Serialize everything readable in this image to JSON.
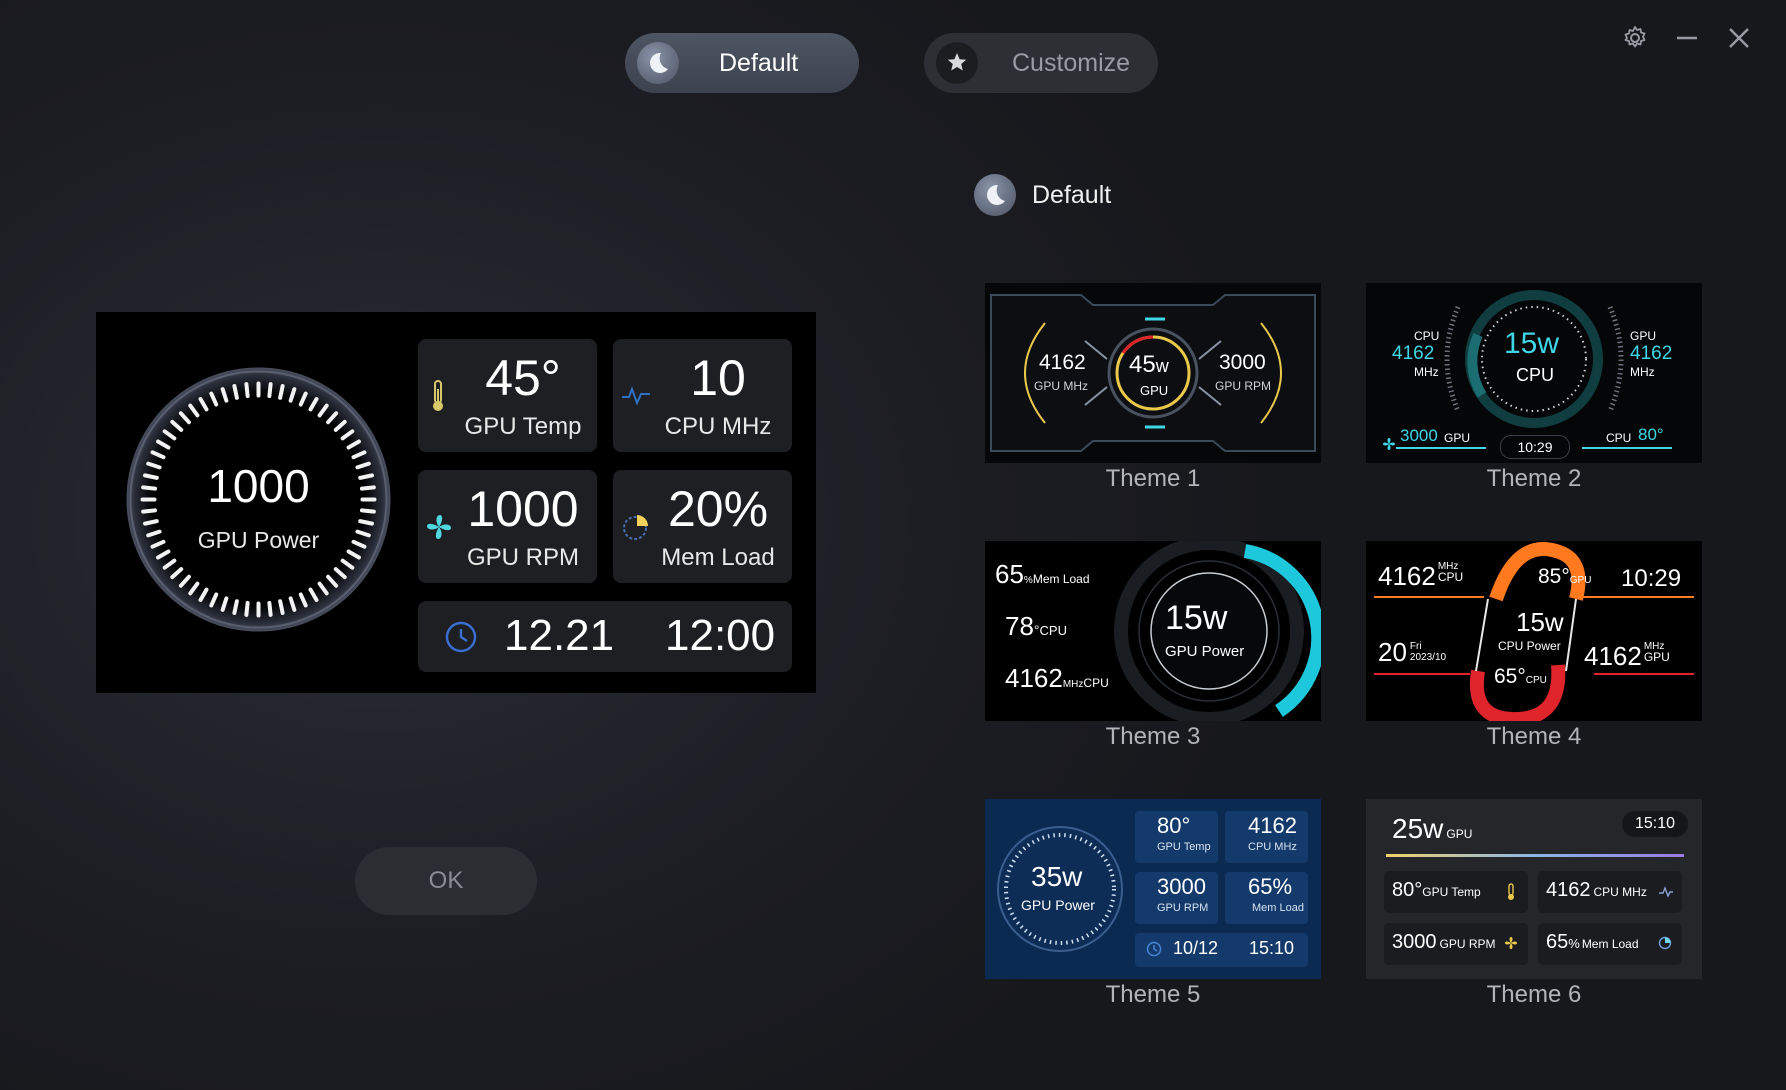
{
  "modes": {
    "default_label": "Default",
    "customize_label": "Customize"
  },
  "window": {
    "settings_icon": "gear-icon",
    "minimize_icon": "minimize-icon",
    "close_icon": "close-icon"
  },
  "preview": {
    "gauge": {
      "value": "1000",
      "caption": "GPU Power"
    },
    "tiles": [
      {
        "value": "45°",
        "caption": "GPU Temp",
        "icon": "thermometer-icon"
      },
      {
        "value": "10",
        "caption": "CPU MHz",
        "icon": "pulse-icon"
      },
      {
        "value": "1000",
        "caption": "GPU RPM",
        "icon": "fan-icon"
      },
      {
        "value": "20%",
        "caption": "Mem Load",
        "icon": "pie-icon"
      }
    ],
    "clock": {
      "date": "12.21",
      "time": "12:00",
      "icon": "clock-icon"
    }
  },
  "ok_label": "OK",
  "theme_section": {
    "title": "Default"
  },
  "themes": [
    {
      "caption": "Theme 1",
      "left": {
        "value": "4162",
        "unit": "GPU MHz"
      },
      "center": {
        "value": "45",
        "suffix": "w",
        "unit": "GPU"
      },
      "right": {
        "value": "3000",
        "unit": "GPU RPM"
      }
    },
    {
      "caption": "Theme 2",
      "cpu_label": "CPU",
      "cpu_value": "4162",
      "cpu_unit": "MHz",
      "center_value": "15w",
      "center_unit": "CPU",
      "gpu_label": "GPU",
      "gpu_value": "4162",
      "gpu_unit": "MHz",
      "rpm_value": "3000",
      "rpm_unit": "GPU",
      "time": "10:29",
      "temp_label": "CPU",
      "temp_value": "80°"
    },
    {
      "caption": "Theme 3",
      "rows": [
        {
          "value": "65",
          "sup": "%",
          "sub": "Mem Load"
        },
        {
          "value": "78",
          "sup": "°",
          "sub": "CPU"
        },
        {
          "value": "4162",
          "sup": "MHz",
          "sub": "CPU"
        }
      ],
      "center_value": "15w",
      "center_unit": "GPU Power"
    },
    {
      "caption": "Theme 4",
      "top_left": {
        "value": "4162",
        "sup": "MHz",
        "sub": "CPU"
      },
      "top_center": {
        "value": "85°",
        "sub": "GPU"
      },
      "time": "10:29",
      "center_value": "15w",
      "center_unit": "CPU Power",
      "date_day": "20",
      "date_weekday": "Fri",
      "date_month": "2023/10",
      "bottom_center": {
        "value": "65°",
        "sub": "CPU"
      },
      "right": {
        "value": "4162",
        "sup": "MHz",
        "sub": "GPU"
      }
    },
    {
      "caption": "Theme 5",
      "gauge_value": "35w",
      "gauge_unit": "GPU Power",
      "cells": [
        {
          "value": "80°",
          "unit": "GPU Temp"
        },
        {
          "value": "4162",
          "unit": "CPU MHz"
        },
        {
          "value": "3000",
          "unit": "GPU RPM"
        },
        {
          "value": "65%",
          "unit": "Mem Load"
        }
      ],
      "date": "10/12",
      "time": "15:10"
    },
    {
      "caption": "Theme 6",
      "power_value": "25w",
      "power_unit": "GPU",
      "time": "15:10",
      "cells": [
        {
          "value": "80°",
          "unit": "GPU Temp"
        },
        {
          "value": "4162",
          "unit": "CPU MHz"
        },
        {
          "value": "3000",
          "unit": "GPU RPM"
        },
        {
          "value": "65",
          "sup": "%",
          "unit": "Mem Load"
        }
      ]
    }
  ],
  "colors": {
    "cyan": "#3fd6e6",
    "yellow": "#e9c84a",
    "orange": "#ff7a1f",
    "red": "#e0242c",
    "theme5_bg": "#0b2a52",
    "theme6_bg": "#25262a"
  }
}
